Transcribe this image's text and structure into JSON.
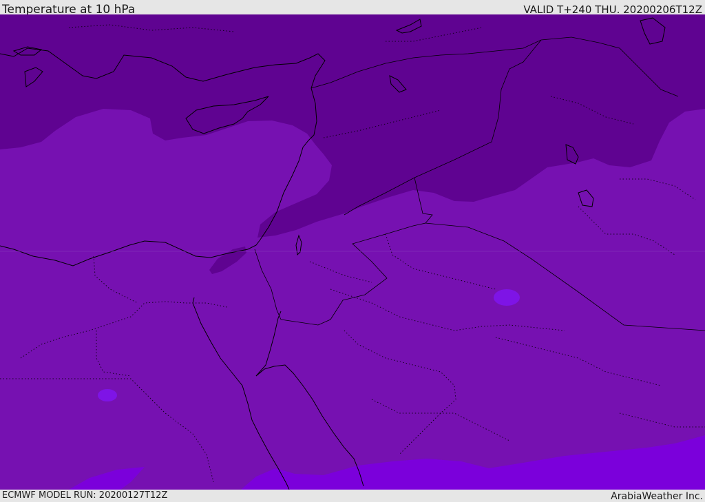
{
  "header": {
    "title": "Temperature at 10 hPa",
    "valid": "VALID T+240 THU. 20200206T12Z"
  },
  "footer": {
    "model_run": "ECMWF MODEL RUN: 20200127T12Z",
    "provider": "ArabiaWeather Inc."
  },
  "map": {
    "colors": {
      "band_cold": "#5f0391",
      "band_mid": "#7611b1",
      "band_warm": "#7b00db",
      "band_warmest": "#7e14e6",
      "coastline": "#000000",
      "header_bg": "#e6e6e6"
    }
  }
}
